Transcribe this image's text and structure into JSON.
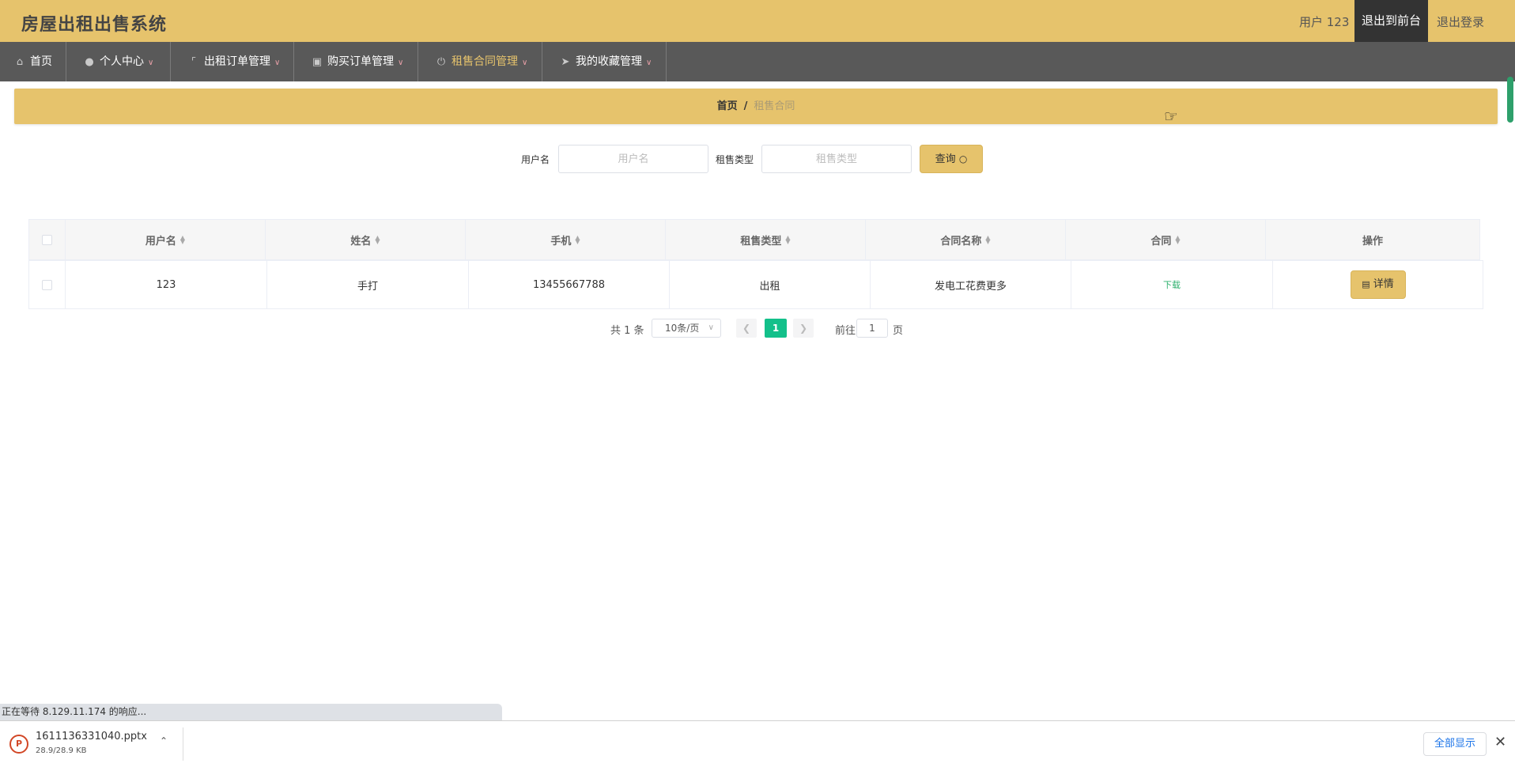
{
  "header": {
    "brand": "房屋出租出售系统",
    "user_label": "用户 123",
    "front_button": "退出到前台",
    "logout_button": "退出登录"
  },
  "nav": {
    "items": [
      {
        "label": "首页",
        "icon": "home-icon"
      },
      {
        "label": "个人中心",
        "icon": "person-icon"
      },
      {
        "label": "出租订单管理",
        "icon": "crop-icon"
      },
      {
        "label": "购买订单管理",
        "icon": "briefcase-icon"
      },
      {
        "label": "租售合同管理",
        "icon": "power-icon"
      },
      {
        "label": "我的收藏管理",
        "icon": "send-icon"
      }
    ]
  },
  "breadcrumb": {
    "home": "首页",
    "separator": "/",
    "current": "租售合同"
  },
  "search": {
    "username_label": "用户名",
    "username_placeholder": "用户名",
    "type_label": "租售类型",
    "type_placeholder": "租售类型",
    "query_button": "查询"
  },
  "table": {
    "columns": [
      "用户名",
      "姓名",
      "手机",
      "租售类型",
      "合同名称",
      "合同",
      "操作"
    ],
    "rows": [
      {
        "username": "123",
        "name": "手打",
        "phone": "13455667788",
        "type": "出租",
        "contract_name": "发电工花费更多",
        "contract": "下载",
        "action": "详情"
      }
    ]
  },
  "pagination": {
    "total": "共 1 条",
    "page_size": "10条/页",
    "current_page": "1",
    "goto_label": "前往",
    "goto_value": "1",
    "page_suffix": "页"
  },
  "browser": {
    "status_text": "正在等待 8.129.11.174 的响应...",
    "download_name": "1611136331040.pptx",
    "download_size": "28.9/28.9 KB",
    "show_all_button": "全部显示"
  }
}
